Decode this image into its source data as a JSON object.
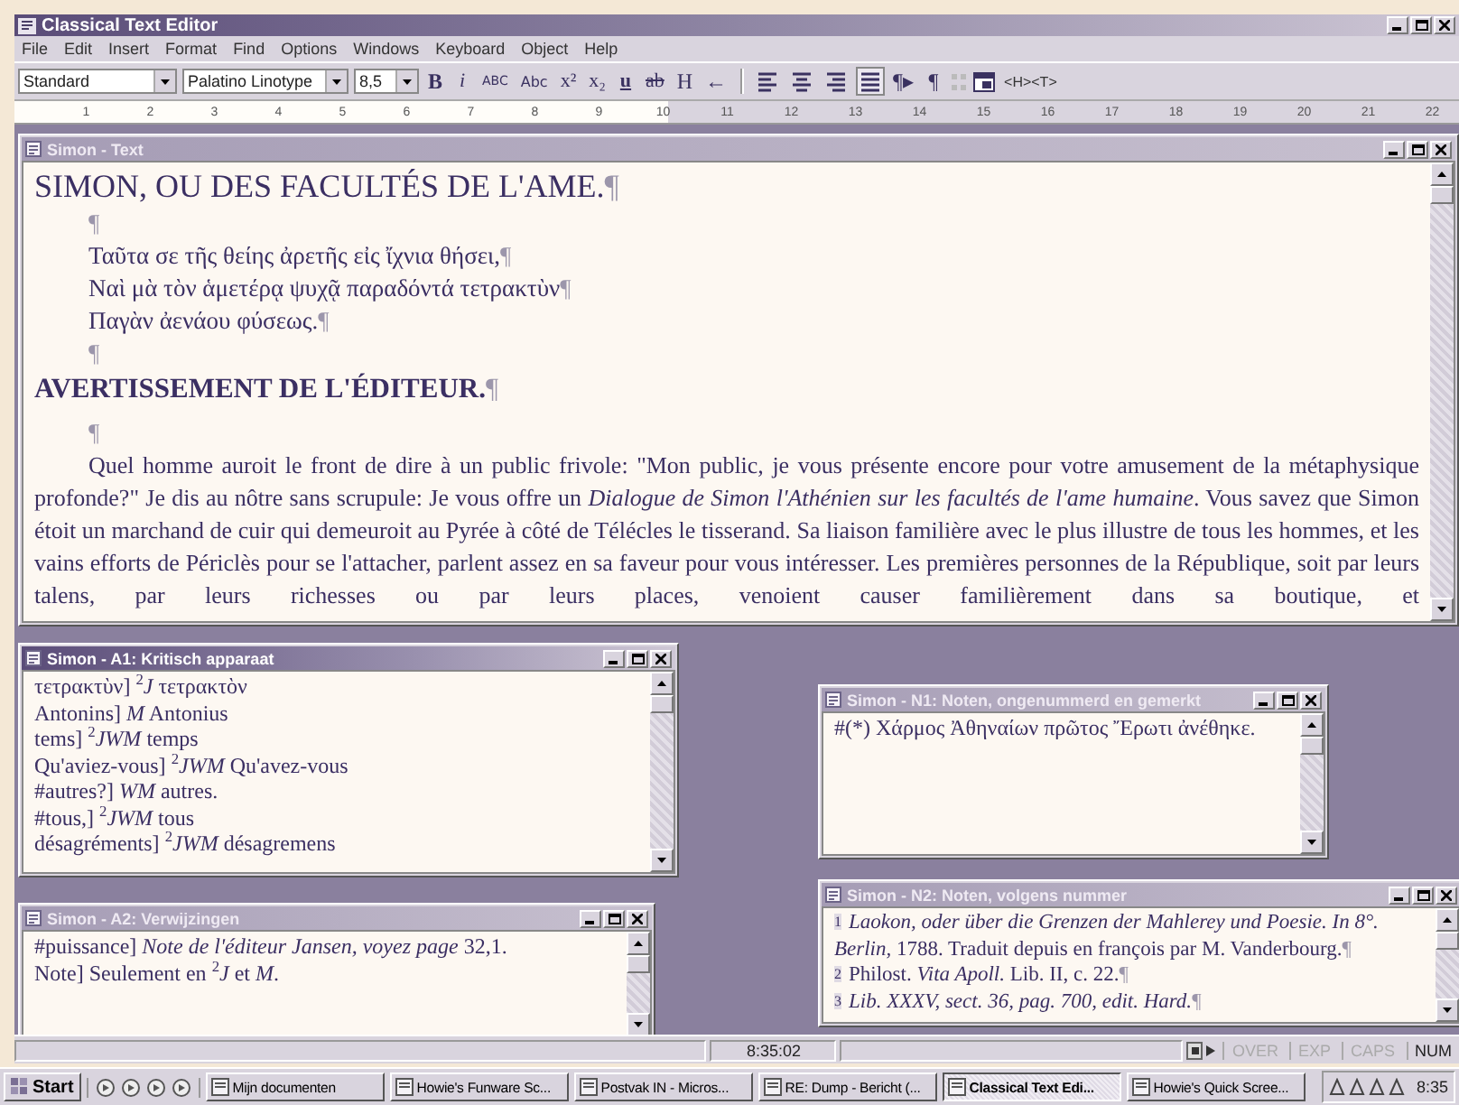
{
  "window": {
    "title": "Classical Text Editor"
  },
  "menu": [
    "File",
    "Edit",
    "Insert",
    "Format",
    "Find",
    "Options",
    "Windows",
    "Keyboard",
    "Object",
    "Help"
  ],
  "toolbar": {
    "style": "Standard",
    "font": "Palatino Linotype",
    "size": "8,5",
    "format_buttons": [
      {
        "kind": "bold",
        "label": "B"
      },
      {
        "kind": "italic",
        "label": "i"
      },
      {
        "kind": "caps",
        "label": "ABC"
      },
      {
        "kind": "smallcaps",
        "label": "Abc"
      },
      {
        "kind": "sup",
        "label": "x²"
      },
      {
        "kind": "sub",
        "label": "x₂"
      },
      {
        "kind": "underline",
        "label": "u"
      },
      {
        "kind": "strike",
        "label": "ab"
      },
      {
        "kind": "plain",
        "label": "H"
      },
      {
        "kind": "plain",
        "label": "←"
      }
    ],
    "align_buttons": [
      {
        "selected": false
      },
      {
        "selected": false
      },
      {
        "selected": false
      },
      {
        "selected": true
      }
    ],
    "pilcrow_buttons": [
      "¶▸",
      "¶"
    ],
    "tag_label": "<H><T>"
  },
  "ruler": [
    "1",
    "2",
    "3",
    "4",
    "5",
    "6",
    "7",
    "8",
    "9",
    "10",
    "11",
    "12",
    "13",
    "14",
    "15",
    "16",
    "17",
    "18",
    "19",
    "20",
    "21",
    "22"
  ],
  "documents": [
    {
      "kind": "text",
      "title": "Simon - Text",
      "active": false,
      "lines": [
        {
          "kind": "heading",
          "text": "SIMON, OU DES FACULTÉS DE L'AME.",
          "mark": "¶"
        },
        {
          "kind": "empty",
          "mark": "¶"
        },
        {
          "kind": "verse",
          "text": "Ταῦτα σε τῆς θείης ἀρετῆς εἰς ἴχνια θήσει,",
          "mark": "¶"
        },
        {
          "kind": "verse",
          "text": "Ναὶ μὰ τὸν ἁμετέρᾳ ψυχᾷ παραδόντά τετρακτὺν",
          "mark": "¶"
        },
        {
          "kind": "verse",
          "text": "Παγὰν ἀενάου φύσεως.",
          "mark": "¶"
        },
        {
          "kind": "empty",
          "mark": "¶"
        },
        {
          "kind": "subheading",
          "text": "AVERTISSEMENT DE L'ÉDITEUR.",
          "mark": "¶"
        },
        {
          "kind": "empty",
          "mark": "¶"
        },
        {
          "kind": "paragraph",
          "text": "Quel homme auroit le front de dire à un public frivole: \"Mon public, je vous présente encore pour votre amusement de la métaphysique profonde?\" Je dis au nôtre sans scrupule: Je vous offre un *Dialogue de Simon l'Athénien sur les facultés de l'ame humaine*. Vous savez que Simon étoit un marchand de cuir qui demeuroit au Pyrée à côté de Télécles le tisserand. Sa liaison familière avec le plus illustre de tous les hommes, et les vains efforts de Périclès pour se l'attacher, parlent assez en sa faveur pour vous intéresser. Les premières personnes de la République, soit par leurs talens, par leurs richesses ou par leurs places, venoient causer familièrement dans sa boutique, et"
        }
      ]
    },
    {
      "kind": "apparatus",
      "title": "Simon - A1: Kritisch apparaat",
      "active": true,
      "lines": [
        {
          "text": "τετρακτὺν] $^{2}$*J* τετρακτὸν"
        },
        {
          "text": "Antonins] *M* Antonius"
        },
        {
          "text": "tems] $^{2}$*JWM* temps"
        },
        {
          "text": "Qu'aviez-vous] $^{2}$*JWM* Qu'avez-vous"
        },
        {
          "text": "#autres?] *WM* autres."
        },
        {
          "text": "#tous,] $^{2}$*JWM* tous"
        },
        {
          "text": "désagréments] $^{2}$*JWM* désagremens"
        }
      ]
    },
    {
      "kind": "apparatus",
      "title": "Simon - A2: Verwijzingen",
      "active": false,
      "lines": [
        {
          "text": "#puissance] *Note de l'éditeur Jansen, voyez page* 32,1."
        },
        {
          "text": "Note] Seulement en $^{2}$*J* et *M*."
        }
      ]
    },
    {
      "kind": "apparatus",
      "title": "Simon - N1: Noten, ongenummerd en gemerkt",
      "active": false,
      "lines": [
        {
          "text": "#(*) Χάρμος Ἀθηναίων πρῶτος Ἔρωτι ἀνέθηκε."
        }
      ]
    },
    {
      "kind": "notes",
      "title": "Simon - N2: Noten, volgens nummer",
      "active": false,
      "lines": [
        {
          "num": "1",
          "text": "*Laokon, oder über die Grenzen der Mahlerey und Poesie. In 8°. Berlin,* 1788. Traduit depuis en françois par M. Vanderbourg.",
          "mark": "¶"
        },
        {
          "num": "2",
          "text": "Philost. *Vita Apoll.* Lib. II, c. 22.",
          "mark": "¶"
        },
        {
          "num": "3",
          "text": "*Lib. XXXV, sect. 36, pag. 700, edit. Hard.*",
          "mark": "¶"
        }
      ]
    }
  ],
  "status_bar": {
    "time": "8:35:02",
    "indicators": [
      {
        "label": "OVER",
        "on": false
      },
      {
        "label": "EXP",
        "on": false
      },
      {
        "label": "CAPS",
        "on": false
      },
      {
        "label": "NUM",
        "on": true
      }
    ]
  },
  "taskbar": {
    "start": "Start",
    "tasks": [
      {
        "label": "Mijn documenten",
        "selected": false
      },
      {
        "label": "Howie's Funware Sc...",
        "selected": false
      },
      {
        "label": "Postvak IN - Micros...",
        "selected": false
      },
      {
        "label": "RE: Dump - Bericht (...",
        "selected": false
      },
      {
        "label": "Classical Text Edi...",
        "selected": true
      },
      {
        "label": "Howie's Quick Scree...",
        "selected": false
      }
    ],
    "clock": "8:35"
  }
}
